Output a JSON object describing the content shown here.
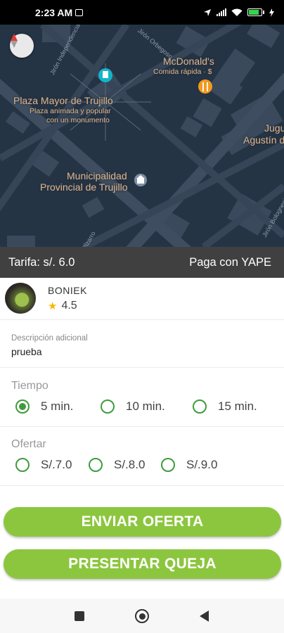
{
  "status_bar": {
    "time": "2:23 AM"
  },
  "map": {
    "labels": {
      "plaza_title": "Plaza Mayor de Trujillo",
      "plaza_sub1": "Plaza animada y popular",
      "plaza_sub2": "con un monumento",
      "mcd_title": "McDonald's",
      "mcd_sub": "Comida rápida · $",
      "muni1": "Municipalidad",
      "muni2": "Provincial de Trujillo",
      "right1": "Jugu",
      "right2": "Agustín d",
      "street_independencia": "Jirón Independencia",
      "street_orbegoso": "Jirón Orbegoso",
      "street_pizarro": "Pizarro",
      "street_right": "Jirón Bolognesi"
    }
  },
  "fare": {
    "left": "Tarifa: s/. 6.0",
    "right": "Paga con YAPE"
  },
  "driver": {
    "name": "BONIEK",
    "rating": "4.5"
  },
  "description": {
    "label": "Descripción adicional",
    "value": "prueba"
  },
  "tiempo": {
    "title": "Tiempo",
    "options": [
      "5 min.",
      "10 min.",
      "15 min."
    ],
    "selected": "5 min."
  },
  "ofertar": {
    "title": "Ofertar",
    "options": [
      "S/.7.0",
      "S/.8.0",
      "S/.9.0"
    ]
  },
  "buttons": {
    "send_offer": "ENVIAR OFERTA",
    "complain": "PRESENTAR QUEJA"
  },
  "colors": {
    "accent": "#8cc63f",
    "radio": "#3f9c3c",
    "map_bg": "#253445",
    "fare_bar": "#404040"
  }
}
